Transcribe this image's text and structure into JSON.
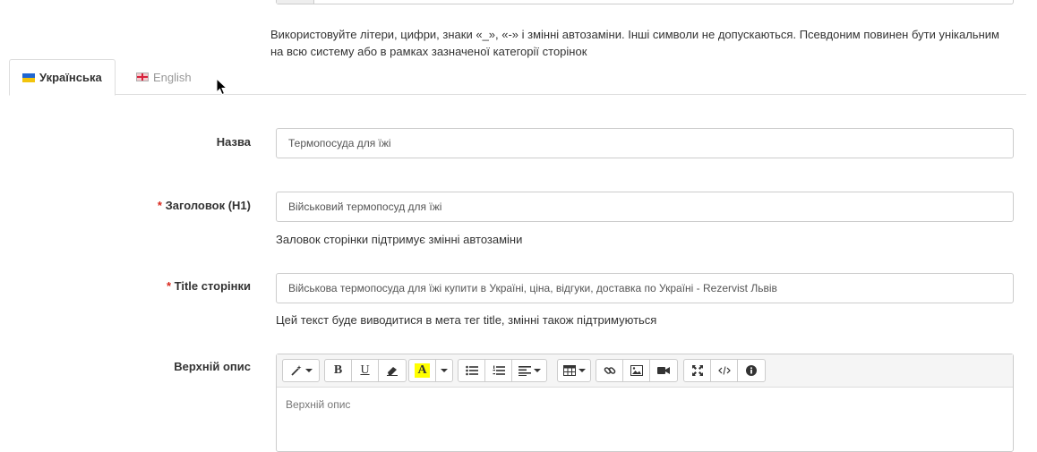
{
  "alias_help": "Використовуйте літери, цифри, знаки «_», «-» і змінні автозаміни. Інші символи не допускаються. Псевдоним повинен бути унікальним на всю систему або в рамках зазначеної категорії сторінок",
  "tabs": [
    {
      "label": "Українська",
      "active": true
    },
    {
      "label": "English",
      "active": false
    }
  ],
  "fields": {
    "name": {
      "label": "Назва",
      "value": "Термопосуда для їжі"
    },
    "heading": {
      "required_mark": "*",
      "label": "Заголовок (H1)",
      "value": "Військовий термопосуд для їжі",
      "help": "Заловок сторінки підтримує змінні автозаміни"
    },
    "title": {
      "required_mark": "*",
      "label": "Title сторінки",
      "value": "Військова термопосуда для їжі купити в Україні, ціна, відгуки, доставка по Україні - Rezervist Львів",
      "help": "Цей текст буде виводитися в мета тег title, змінні також підтримуються"
    },
    "top_description": {
      "label": "Верхній опис",
      "placeholder": "Верхній опис"
    }
  },
  "toolbar": {
    "bold": "B",
    "underline": "U",
    "font_color": "A",
    "font_color_hex": "#ffff00"
  }
}
